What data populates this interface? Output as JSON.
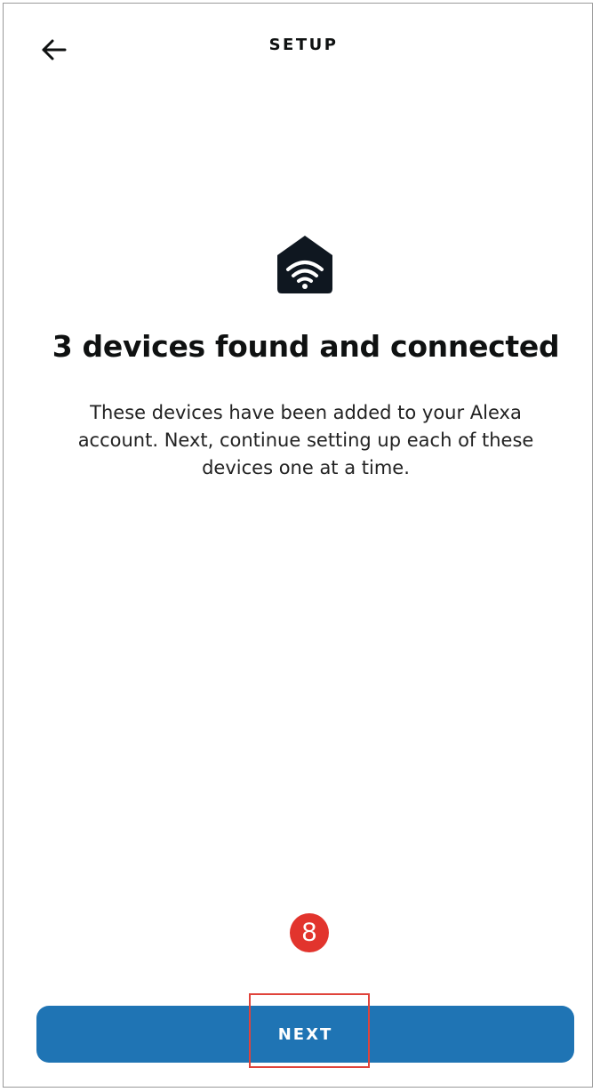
{
  "header": {
    "title": "SETUP",
    "back_icon": "arrow-left-icon"
  },
  "main": {
    "icon": "smart-home-wifi-icon",
    "headline": "3 devices found and connected",
    "description": "These devices have been added to your Alexa account. Next, continue setting up each of these devices one at a time."
  },
  "annotation": {
    "step_number": "8",
    "badge_color": "#e2342d",
    "highlight_color": "#e0433b"
  },
  "footer": {
    "next_label": "NEXT",
    "button_color": "#1f74b4"
  }
}
